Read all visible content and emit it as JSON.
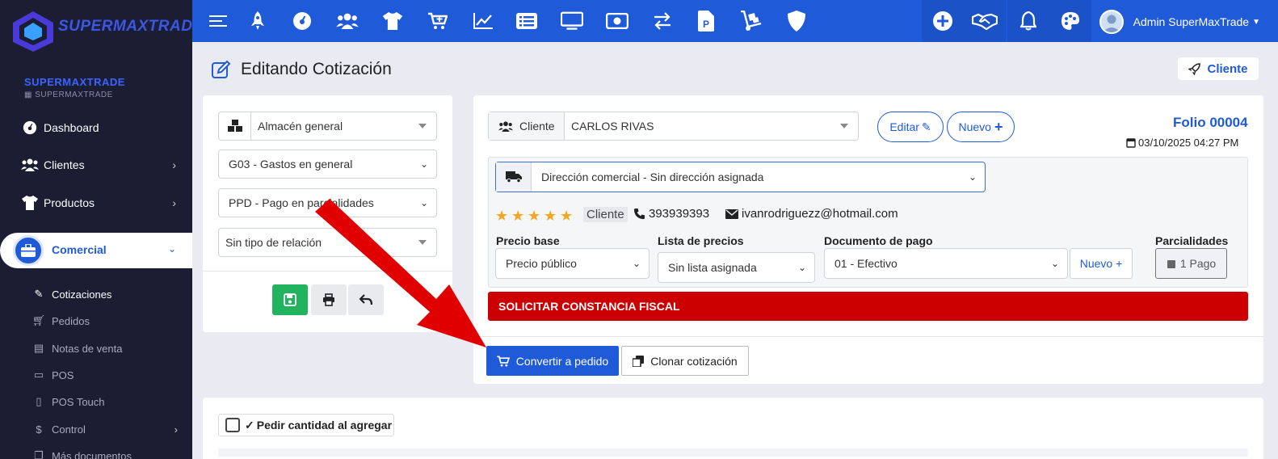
{
  "sidebar": {
    "logo_text": "SUPERMAXTRADE",
    "org_name": "SUPERMAXTRADE",
    "org_sub": "SUPERMAXTRADE",
    "items": [
      {
        "label": "Dashboard",
        "icon": "dashboard-icon"
      },
      {
        "label": "Clientes",
        "icon": "users-icon"
      },
      {
        "label": "Productos",
        "icon": "shirt-icon"
      },
      {
        "label": "Comercial",
        "icon": "briefcase-icon"
      }
    ],
    "subitems": [
      {
        "label": "Cotizaciones",
        "icon": "edit-icon"
      },
      {
        "label": "Pedidos",
        "icon": "cart-icon"
      },
      {
        "label": "Notas de venta",
        "icon": "list-icon"
      },
      {
        "label": "POS",
        "icon": "monitor-icon"
      },
      {
        "label": "POS Touch",
        "icon": "tablet-icon"
      },
      {
        "label": "Control",
        "icon": "dollar-icon"
      },
      {
        "label": "Más documentos",
        "icon": "docs-icon"
      }
    ]
  },
  "topbar": {
    "user_name": "Admin SuperMaxTrade"
  },
  "page": {
    "title": "Editando Cotización",
    "cliente_button": "Cliente"
  },
  "left_card": {
    "almacen": "Almacén general",
    "uso_cfdi": "G03 - Gastos en general",
    "metodo_pago": "PPD - Pago en parcialidades",
    "tipo_relacion": "Sin tipo de relación"
  },
  "main_card": {
    "cliente_label": "Cliente",
    "cliente_value": "CARLOS RIVAS",
    "editar": "Editar",
    "nuevo": "Nuevo",
    "folio": "Folio 00004",
    "fecha": "03/10/2025 04:27 PM",
    "direccion": "Dirección comercial - Sin dirección asignada",
    "tag": "Cliente",
    "telefono": "393939393",
    "email": "ivanrodriguezz@hotmail.com",
    "rating": 5,
    "precio_base_label": "Precio base",
    "precio_base": "Precio público",
    "lista_precios_label": "Lista de precios",
    "lista_precios": "Sin lista asignada",
    "documento_pago_label": "Documento de pago",
    "documento_pago": "01 - Efectivo",
    "nuevo_plus": "Nuevo +",
    "parcialidades_label": "Parcialidades",
    "parcialidades": "1 Pago",
    "banner": "SOLICITAR CONSTANCIA FISCAL",
    "convertir": "Convertir a pedido",
    "clonar": "Clonar cotización"
  },
  "bottom_card": {
    "pedir_cantidad": "Pedir cantidad al agregar"
  },
  "colors": {
    "primary": "#1f5bd9",
    "sidebar": "#1b1d33",
    "danger": "#cc0000",
    "success": "#22b35e",
    "arrow": "#e00000"
  }
}
